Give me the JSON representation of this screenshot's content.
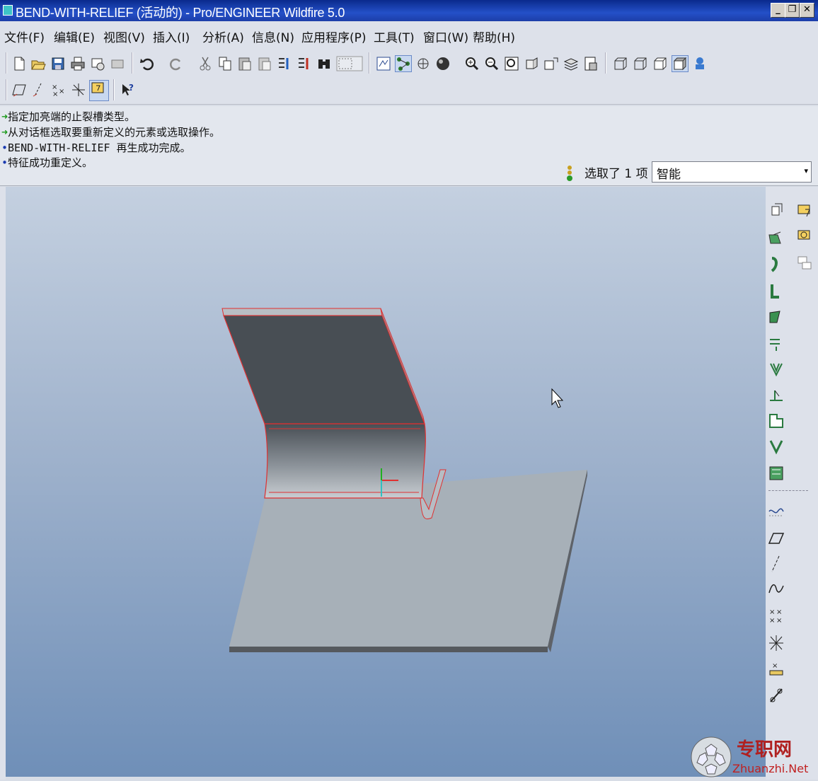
{
  "window": {
    "title": "BEND-WITH-RELIEF (活动的) - Pro/ENGINEER Wildfire 5.0",
    "controls": {
      "minimize": "_",
      "maximize": "❐",
      "close": "✕"
    }
  },
  "menu": [
    "文件(F)",
    "编辑(E)",
    "视图(V)",
    "插入(I)",
    "分析(A)",
    "信息(N)",
    "应用程序(P)",
    "工具(T)",
    "窗口(W)",
    "帮助(H)"
  ],
  "toolbar": {
    "row1": [
      "new-icon",
      "open-icon",
      "save-icon",
      "print-icon",
      "send-icon",
      "close-window-icon",
      "undo-icon",
      "redo-icon",
      "cut-icon",
      "copy-icon",
      "paste-icon",
      "paste-special-icon",
      "regenerate-icon",
      "regen-manager-icon",
      "find-icon",
      "select-box-icon",
      "repaint-icon",
      "spin-center-icon",
      "orient-icon",
      "shading-icon",
      "zoom-in-icon",
      "zoom-out-icon",
      "refit-icon",
      "reorient-icon",
      "saved-views-icon",
      "layers-icon",
      "view-manager-icon",
      "wireframe-icon",
      "hidden-line-icon",
      "no-hidden-icon",
      "shaded-icon",
      "model-tree-icon"
    ],
    "row2": [
      "datum-plane-display-icon",
      "datum-axis-display-icon",
      "point-display-icon",
      "csys-display-icon",
      "annotation-display-icon",
      "context-help-icon"
    ]
  },
  "messages": [
    {
      "type": "arrow",
      "text": "指定加亮端的止裂槽类型。"
    },
    {
      "type": "arrow",
      "text": "从对话框选取要重新定义的元素或选取操作。"
    },
    {
      "type": "info",
      "text": "BEND-WITH-RELIEF 再生成功完成。"
    },
    {
      "type": "info",
      "text": "特征成功重定义。"
    }
  ],
  "status": {
    "selection_text": "选取了 1 项",
    "filter_value": "智能",
    "filter_arrow": "▾"
  },
  "right_toolbar": [
    "wall-icon",
    "flat-wall-icon",
    "flange-icon",
    "extend-icon",
    "unbend-icon",
    "bend-back-icon",
    "form-icon",
    "notch-icon",
    "rip-icon",
    "merge-icon",
    "flatten-icon",
    "datum-plane-icon",
    "datum-axis-icon",
    "datum-curve-icon",
    "datum-point-icon",
    "csys-icon",
    "analysis-icon",
    "sketch-icon",
    "note-icon",
    "table-icon",
    "dimension-icon"
  ],
  "watermark": {
    "cn": "专职网",
    "en": "Zhuanzhi.Net"
  },
  "colors": {
    "title_bg": "#0a2a8c",
    "viewport_top": "#c4d0e0",
    "viewport_bottom": "#6f8fb8",
    "part_highlight": "#e03030",
    "part_surface": "#a8b0b8"
  }
}
